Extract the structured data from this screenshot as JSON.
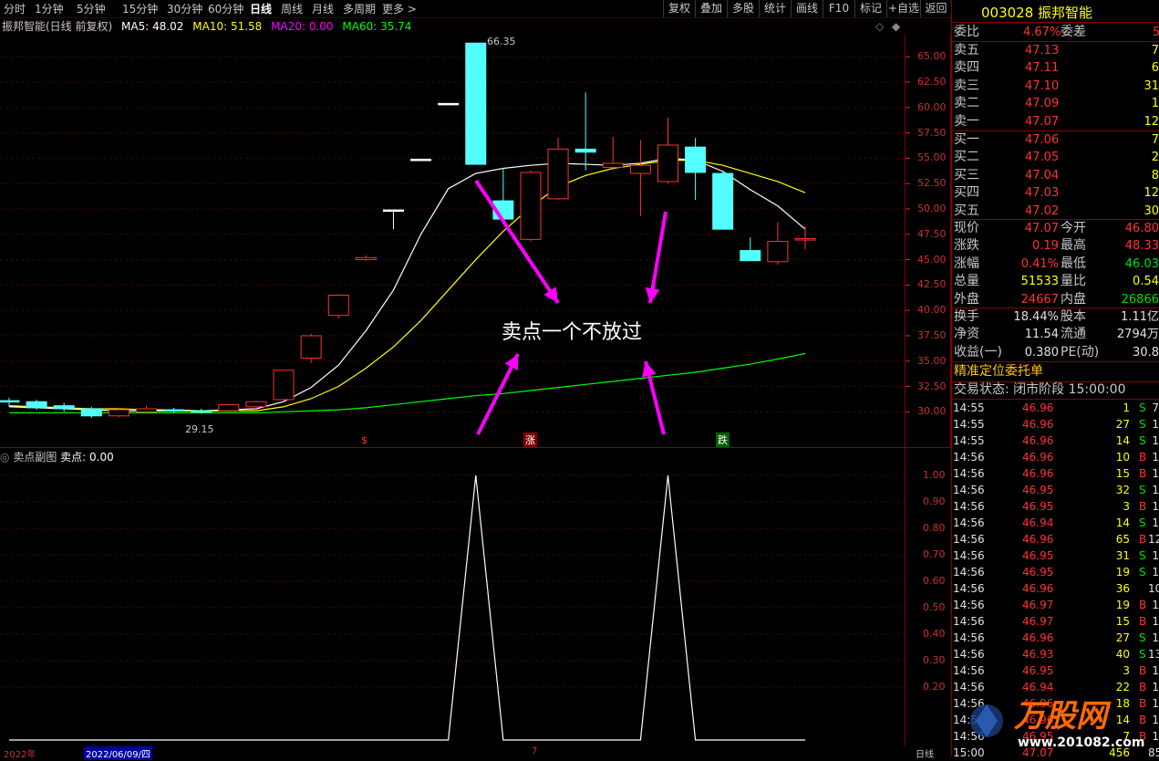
{
  "periods": [
    "分时",
    "1分钟",
    "5分钟",
    "15分钟",
    "30分钟",
    "60分钟",
    "日线",
    "周线",
    "月线",
    "多周期",
    "更多 >"
  ],
  "active_period": "日线",
  "toolbar": [
    "复权",
    "叠加",
    "多股",
    "统计",
    "画线",
    "F10",
    "标记",
    "+自选",
    "返回"
  ],
  "chart_info": {
    "name": "振邦智能(日线 前复权)",
    "ma5": "MA5: 48.02",
    "ma10": "MA10: 51.58",
    "ma20": "MA20: 0.00",
    "ma60": "MA60: 35.74",
    "colors": {
      "ma5": "#ffffff",
      "ma10": "#ffff00",
      "ma20": "#ff00ff",
      "ma60": "#00ff00"
    }
  },
  "price_axis": [
    "65.00",
    "62.50",
    "60.00",
    "57.50",
    "55.00",
    "52.50",
    "50.00",
    "47.50",
    "45.00",
    "42.50",
    "40.00",
    "37.50",
    "35.00",
    "32.50",
    "30.00"
  ],
  "high_label": "66.35",
  "low_label": "29.15",
  "markers": {
    "s": "$",
    "zhang": "涨",
    "die": "跌"
  },
  "annotation": "卖点一个不放过",
  "sub_chart": {
    "title": "卖点副图",
    "value_label": "卖点: 0.00",
    "axis": [
      "1.00",
      "0.90",
      "0.80",
      "0.70",
      "0.60",
      "0.50",
      "0.40",
      "0.30",
      "0.20"
    ]
  },
  "bottom_axis": {
    "year": "2022年",
    "date": "2022/06/09/四",
    "mark": "7",
    "mode": "日线"
  },
  "chart_data": {
    "type": "candlestick",
    "price_ylim": [
      28.5,
      67
    ],
    "candles": [
      {
        "o": 31.0,
        "c": 31.1,
        "h": 31.4,
        "l": 30.5,
        "dir": "down"
      },
      {
        "o": 31.0,
        "c": 30.4,
        "h": 31.2,
        "l": 30.2,
        "dir": "down"
      },
      {
        "o": 30.6,
        "c": 30.3,
        "h": 30.9,
        "l": 30.0,
        "dir": "down"
      },
      {
        "o": 30.3,
        "c": 29.6,
        "h": 30.5,
        "l": 29.4,
        "dir": "down"
      },
      {
        "o": 29.6,
        "c": 30.2,
        "h": 30.4,
        "l": 29.5,
        "dir": "up"
      },
      {
        "o": 30.0,
        "c": 30.3,
        "h": 30.6,
        "l": 29.8,
        "dir": "up"
      },
      {
        "o": 30.2,
        "c": 30.1,
        "h": 30.4,
        "l": 29.9,
        "dir": "down"
      },
      {
        "o": 30.1,
        "c": 30.0,
        "h": 30.3,
        "l": 29.8,
        "dir": "down"
      },
      {
        "o": 30.1,
        "c": 30.7,
        "h": 30.8,
        "l": 29.9,
        "dir": "up"
      },
      {
        "o": 30.5,
        "c": 31.0,
        "h": 31.1,
        "l": 30.3,
        "dir": "up"
      },
      {
        "o": 31.2,
        "c": 34.1,
        "h": 34.1,
        "l": 31.0,
        "dir": "up"
      },
      {
        "o": 35.3,
        "c": 37.5,
        "h": 37.7,
        "l": 34.8,
        "dir": "up"
      },
      {
        "o": 39.5,
        "c": 41.5,
        "h": 41.6,
        "l": 39.2,
        "dir": "up"
      },
      {
        "o": 45.0,
        "c": 45.2,
        "h": 45.4,
        "l": 44.9,
        "dir": "up"
      },
      {
        "o": 49.9,
        "c": 49.9,
        "h": 49.9,
        "l": 48.0,
        "dir": "flat"
      },
      {
        "o": 54.9,
        "c": 54.9,
        "h": 54.9,
        "l": 54.9,
        "dir": "flat"
      },
      {
        "o": 60.4,
        "c": 60.4,
        "h": 60.4,
        "l": 60.4,
        "dir": "flat"
      },
      {
        "o": 66.35,
        "c": 54.4,
        "h": 66.35,
        "l": 54.4,
        "dir": "down"
      },
      {
        "o": 50.8,
        "c": 49.0,
        "h": 54.0,
        "l": 48.5,
        "dir": "down"
      },
      {
        "o": 47.0,
        "c": 53.6,
        "h": 53.8,
        "l": 46.8,
        "dir": "up"
      },
      {
        "o": 51.0,
        "c": 55.9,
        "h": 57.0,
        "l": 50.9,
        "dir": "up"
      },
      {
        "o": 55.9,
        "c": 55.6,
        "h": 61.5,
        "l": 53.8,
        "dir": "down"
      },
      {
        "o": 54.1,
        "c": 54.5,
        "h": 57.1,
        "l": 53.8,
        "dir": "up"
      },
      {
        "o": 53.5,
        "c": 54.3,
        "h": 56.8,
        "l": 49.3,
        "dir": "up"
      },
      {
        "o": 52.7,
        "c": 56.3,
        "h": 59.0,
        "l": 52.5,
        "dir": "up"
      },
      {
        "o": 56.1,
        "c": 53.6,
        "h": 57.0,
        "l": 50.9,
        "dir": "down"
      },
      {
        "o": 53.5,
        "c": 48.0,
        "h": 53.8,
        "l": 48.0,
        "dir": "down"
      },
      {
        "o": 45.9,
        "c": 44.9,
        "h": 47.2,
        "l": 44.9,
        "dir": "down"
      },
      {
        "o": 44.8,
        "c": 46.8,
        "h": 48.7,
        "l": 44.5,
        "dir": "up"
      },
      {
        "o": 47.0,
        "c": 47.07,
        "h": 48.3,
        "l": 46.0,
        "dir": "up"
      }
    ],
    "ma5": [
      30.5,
      30.4,
      30.3,
      30.2,
      30.1,
      30.1,
      30.1,
      30.1,
      30.2,
      30.3,
      31.0,
      32.4,
      34.6,
      38.0,
      42.0,
      47.5,
      52.0,
      53.5,
      54.0,
      54.3,
      54.5,
      54.4,
      54.3,
      54.5,
      55.0,
      54.8,
      53.7,
      51.9,
      50.3,
      48.0
    ],
    "ma10": [
      30.6,
      30.5,
      30.4,
      30.3,
      30.3,
      30.2,
      30.2,
      30.1,
      30.1,
      30.1,
      30.5,
      31.3,
      32.5,
      34.3,
      36.4,
      39.0,
      42.0,
      45.0,
      47.8,
      50.2,
      52.2,
      53.3,
      54.0,
      54.4,
      54.8,
      54.8,
      54.3,
      53.5,
      52.7,
      51.6
    ],
    "ma60": [
      29.9,
      29.9,
      29.9,
      29.9,
      29.9,
      29.9,
      29.9,
      29.9,
      29.9,
      29.9,
      30.0,
      30.1,
      30.2,
      30.4,
      30.7,
      31.0,
      31.3,
      31.6,
      31.8,
      32.1,
      32.4,
      32.7,
      33.0,
      33.3,
      33.6,
      33.9,
      34.3,
      34.7,
      35.2,
      35.74
    ],
    "sell_signal": [
      0,
      0,
      0,
      0,
      0,
      0,
      0,
      0,
      0,
      0,
      0,
      0,
      0,
      0,
      0,
      0,
      0,
      1,
      0,
      0,
      0,
      0,
      0,
      0,
      1,
      0,
      0,
      0,
      0,
      0
    ],
    "sub_ylim": [
      0,
      1.1
    ]
  },
  "right_panel": {
    "code": "003028",
    "name": "振邦智能",
    "weibi_label": "委比",
    "weibi": "4.67%",
    "weicha_label": "委差",
    "weicha": "5",
    "sell": [
      {
        "label": "卖五",
        "price": "47.13",
        "vol": "7"
      },
      {
        "label": "卖四",
        "price": "47.11",
        "vol": "6"
      },
      {
        "label": "卖三",
        "price": "47.10",
        "vol": "31"
      },
      {
        "label": "卖二",
        "price": "47.09",
        "vol": "1"
      },
      {
        "label": "卖一",
        "price": "47.07",
        "vol": "12"
      }
    ],
    "buy": [
      {
        "label": "买一",
        "price": "47.06",
        "vol": "7"
      },
      {
        "label": "买二",
        "price": "47.05",
        "vol": "2"
      },
      {
        "label": "买三",
        "price": "47.04",
        "vol": "8"
      },
      {
        "label": "买四",
        "price": "47.03",
        "vol": "12"
      },
      {
        "label": "买五",
        "price": "47.02",
        "vol": "30"
      }
    ],
    "stats": [
      {
        "l1": "现价",
        "v1": "47.07",
        "c1": "red",
        "l2": "今开",
        "v2": "46.80",
        "c2": "red"
      },
      {
        "l1": "涨跌",
        "v1": "0.19",
        "c1": "red",
        "l2": "最高",
        "v2": "48.33",
        "c2": "red"
      },
      {
        "l1": "涨幅",
        "v1": "0.41%",
        "c1": "red",
        "l2": "最低",
        "v2": "46.03",
        "c2": "green"
      },
      {
        "l1": "总量",
        "v1": "51533",
        "c1": "yellow",
        "l2": "量比",
        "v2": "0.54",
        "c2": "yellow"
      },
      {
        "l1": "外盘",
        "v1": "24667",
        "c1": "red",
        "l2": "内盘",
        "v2": "26866",
        "c2": "green"
      }
    ],
    "stats2": [
      {
        "l1": "换手",
        "v1": "18.44%",
        "l2": "股本",
        "v2": "1.11亿"
      },
      {
        "l1": "净资",
        "v1": "11.54",
        "l2": "流通",
        "v2": "2794万"
      },
      {
        "l1": "收益(一)",
        "v1": "0.380",
        "l2": "PE(动)",
        "v2": "30.8"
      }
    ],
    "precise": "精准定位委托单",
    "trade_status": "交易状态: 闭市阶段 15:00:00",
    "ticks": [
      {
        "t": "14:55",
        "p": "46.96",
        "v": "1",
        "s": "S",
        "x": "7"
      },
      {
        "t": "14:55",
        "p": "46.96",
        "v": "27",
        "s": "S",
        "x": "1"
      },
      {
        "t": "14:55",
        "p": "46.96",
        "v": "14",
        "s": "S",
        "x": "1"
      },
      {
        "t": "14:56",
        "p": "46.96",
        "v": "10",
        "s": "B",
        "x": "1"
      },
      {
        "t": "14:56",
        "p": "46.96",
        "v": "15",
        "s": "B",
        "x": "1"
      },
      {
        "t": "14:56",
        "p": "46.95",
        "v": "32",
        "s": "S",
        "x": "1"
      },
      {
        "t": "14:56",
        "p": "46.95",
        "v": "3",
        "s": "B",
        "x": "1"
      },
      {
        "t": "14:56",
        "p": "46.94",
        "v": "14",
        "s": "S",
        "x": "1"
      },
      {
        "t": "14:56",
        "p": "46.96",
        "v": "65",
        "s": "B",
        "x": "12"
      },
      {
        "t": "14:56",
        "p": "46.95",
        "v": "31",
        "s": "S",
        "x": "1"
      },
      {
        "t": "14:56",
        "p": "46.95",
        "v": "19",
        "s": "S",
        "x": "1"
      },
      {
        "t": "14:56",
        "p": "46.96",
        "v": "36",
        "s": "",
        "x": "10"
      },
      {
        "t": "14:56",
        "p": "46.97",
        "v": "19",
        "s": "B",
        "x": "1"
      },
      {
        "t": "14:56",
        "p": "46.97",
        "v": "15",
        "s": "B",
        "x": "1"
      },
      {
        "t": "14:56",
        "p": "46.96",
        "v": "27",
        "s": "S",
        "x": "1"
      },
      {
        "t": "14:56",
        "p": "46.93",
        "v": "40",
        "s": "S",
        "x": "13"
      },
      {
        "t": "14:56",
        "p": "46.95",
        "v": "3",
        "s": "B",
        "x": "1"
      },
      {
        "t": "14:56",
        "p": "46.94",
        "v": "22",
        "s": "B",
        "x": "1"
      },
      {
        "t": "14:56",
        "p": "46.96",
        "v": "18",
        "s": "B",
        "x": "1"
      },
      {
        "t": "14:56",
        "p": "46.96",
        "v": "14",
        "s": "B",
        "x": "1"
      },
      {
        "t": "14:56",
        "p": "46.95",
        "v": "7",
        "s": "B",
        "x": "1"
      },
      {
        "t": "15:00",
        "p": "47.07",
        "v": "456",
        "s": "",
        "x": "85"
      }
    ],
    "watermark": "万股网",
    "watermark_url": "www.201082.com"
  }
}
